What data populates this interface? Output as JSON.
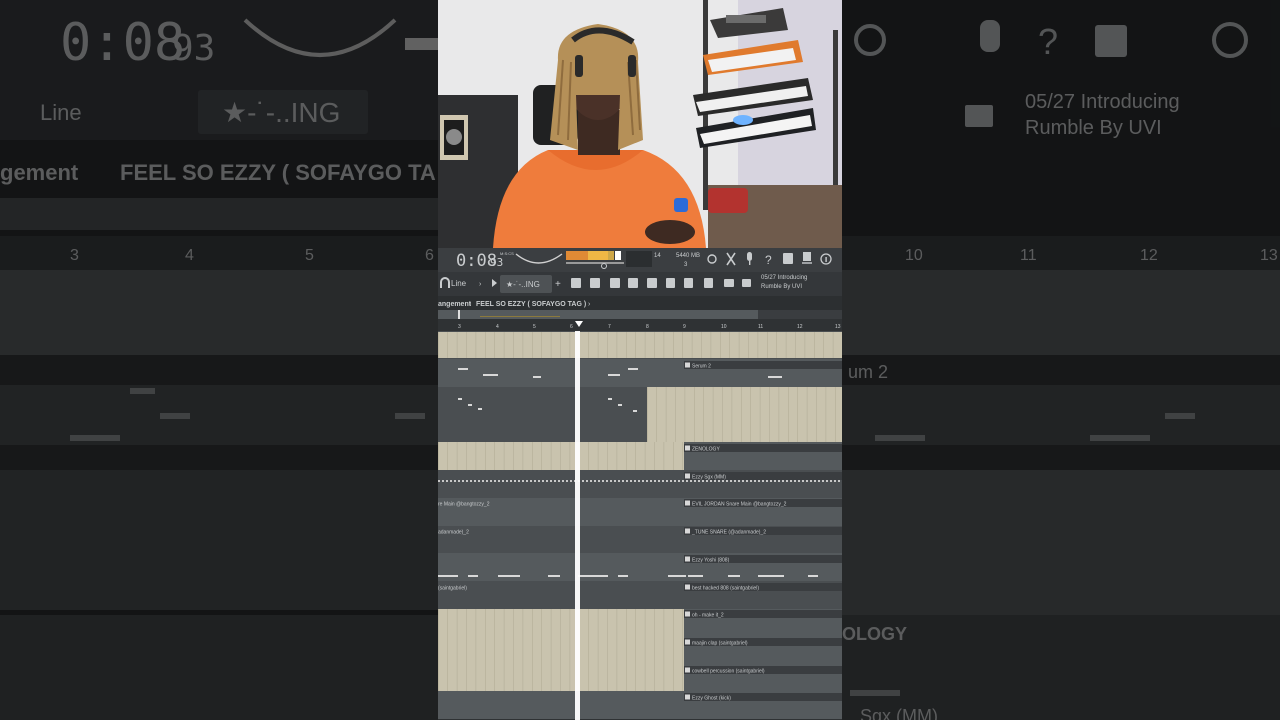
{
  "transport": {
    "time_main": "0:08",
    "time_frac": "93",
    "time_format": "M:S:CS",
    "cpu": "14",
    "memory": "5440 MB",
    "voices": "3"
  },
  "toolbar": {
    "snap_mode": "Line",
    "pattern_name": "★-˙-..ING",
    "add_label": "+",
    "news_line1": "05/27 Introducing",
    "news_line2": "Rumble By UVI"
  },
  "breadcrumb": {
    "section": "angement",
    "separator": "›",
    "project": "FEEL SO EZZY ( SOFAYGO TAG )"
  },
  "background": {
    "breadcrumb_section": "gement",
    "project": "FEEL SO EZZY ( SOFAYGO TA",
    "news_line1": "05/27  Introducing",
    "news_line2": "Rumble By UVI",
    "track_label_1": "um 2",
    "track_label_2": "OLOGY",
    "track_label_3": "Sgx (MM)"
  },
  "timeline": {
    "bars": [
      "3",
      "4",
      "5",
      "6",
      "7",
      "8",
      "9",
      "10",
      "11",
      "12",
      "13"
    ]
  },
  "clips": [
    "Serum 2",
    "ZENOLOGY",
    "Ezzy  Sgx (MM)",
    "EVIL JORDAN Snare Main @bangtozzy_2",
    "_TUNE SNARE (@adanmade)_2",
    "Ezzy  Yoshi (808)",
    "best hacked 808 (saintgabriel)",
    "oh - make it_2",
    "maajin clap (saintgabriel)",
    "cowbell percussion (saintgabriel)",
    "Ezzy  Ghost (kick)"
  ],
  "left_fragments": [
    "re Main @bangtozzy_2",
    "adanmade)_2",
    "(saintgabriel)"
  ],
  "colors": {
    "clip_fill": "#c9c3ae",
    "lane_dark": "#4a4e51",
    "lane_light": "#555a5d",
    "playhead": "#ffffff",
    "accent_orange": "#e08a35",
    "accent_yellow": "#f2c24a",
    "hoodie_orange": "#ef7c3c"
  },
  "icons": [
    "refresh-icon",
    "cut-icon",
    "mic-icon",
    "help-icon",
    "save-icon",
    "export-icon",
    "info-icon",
    "metronome-icon",
    "snap-icon",
    "cart-icon"
  ]
}
